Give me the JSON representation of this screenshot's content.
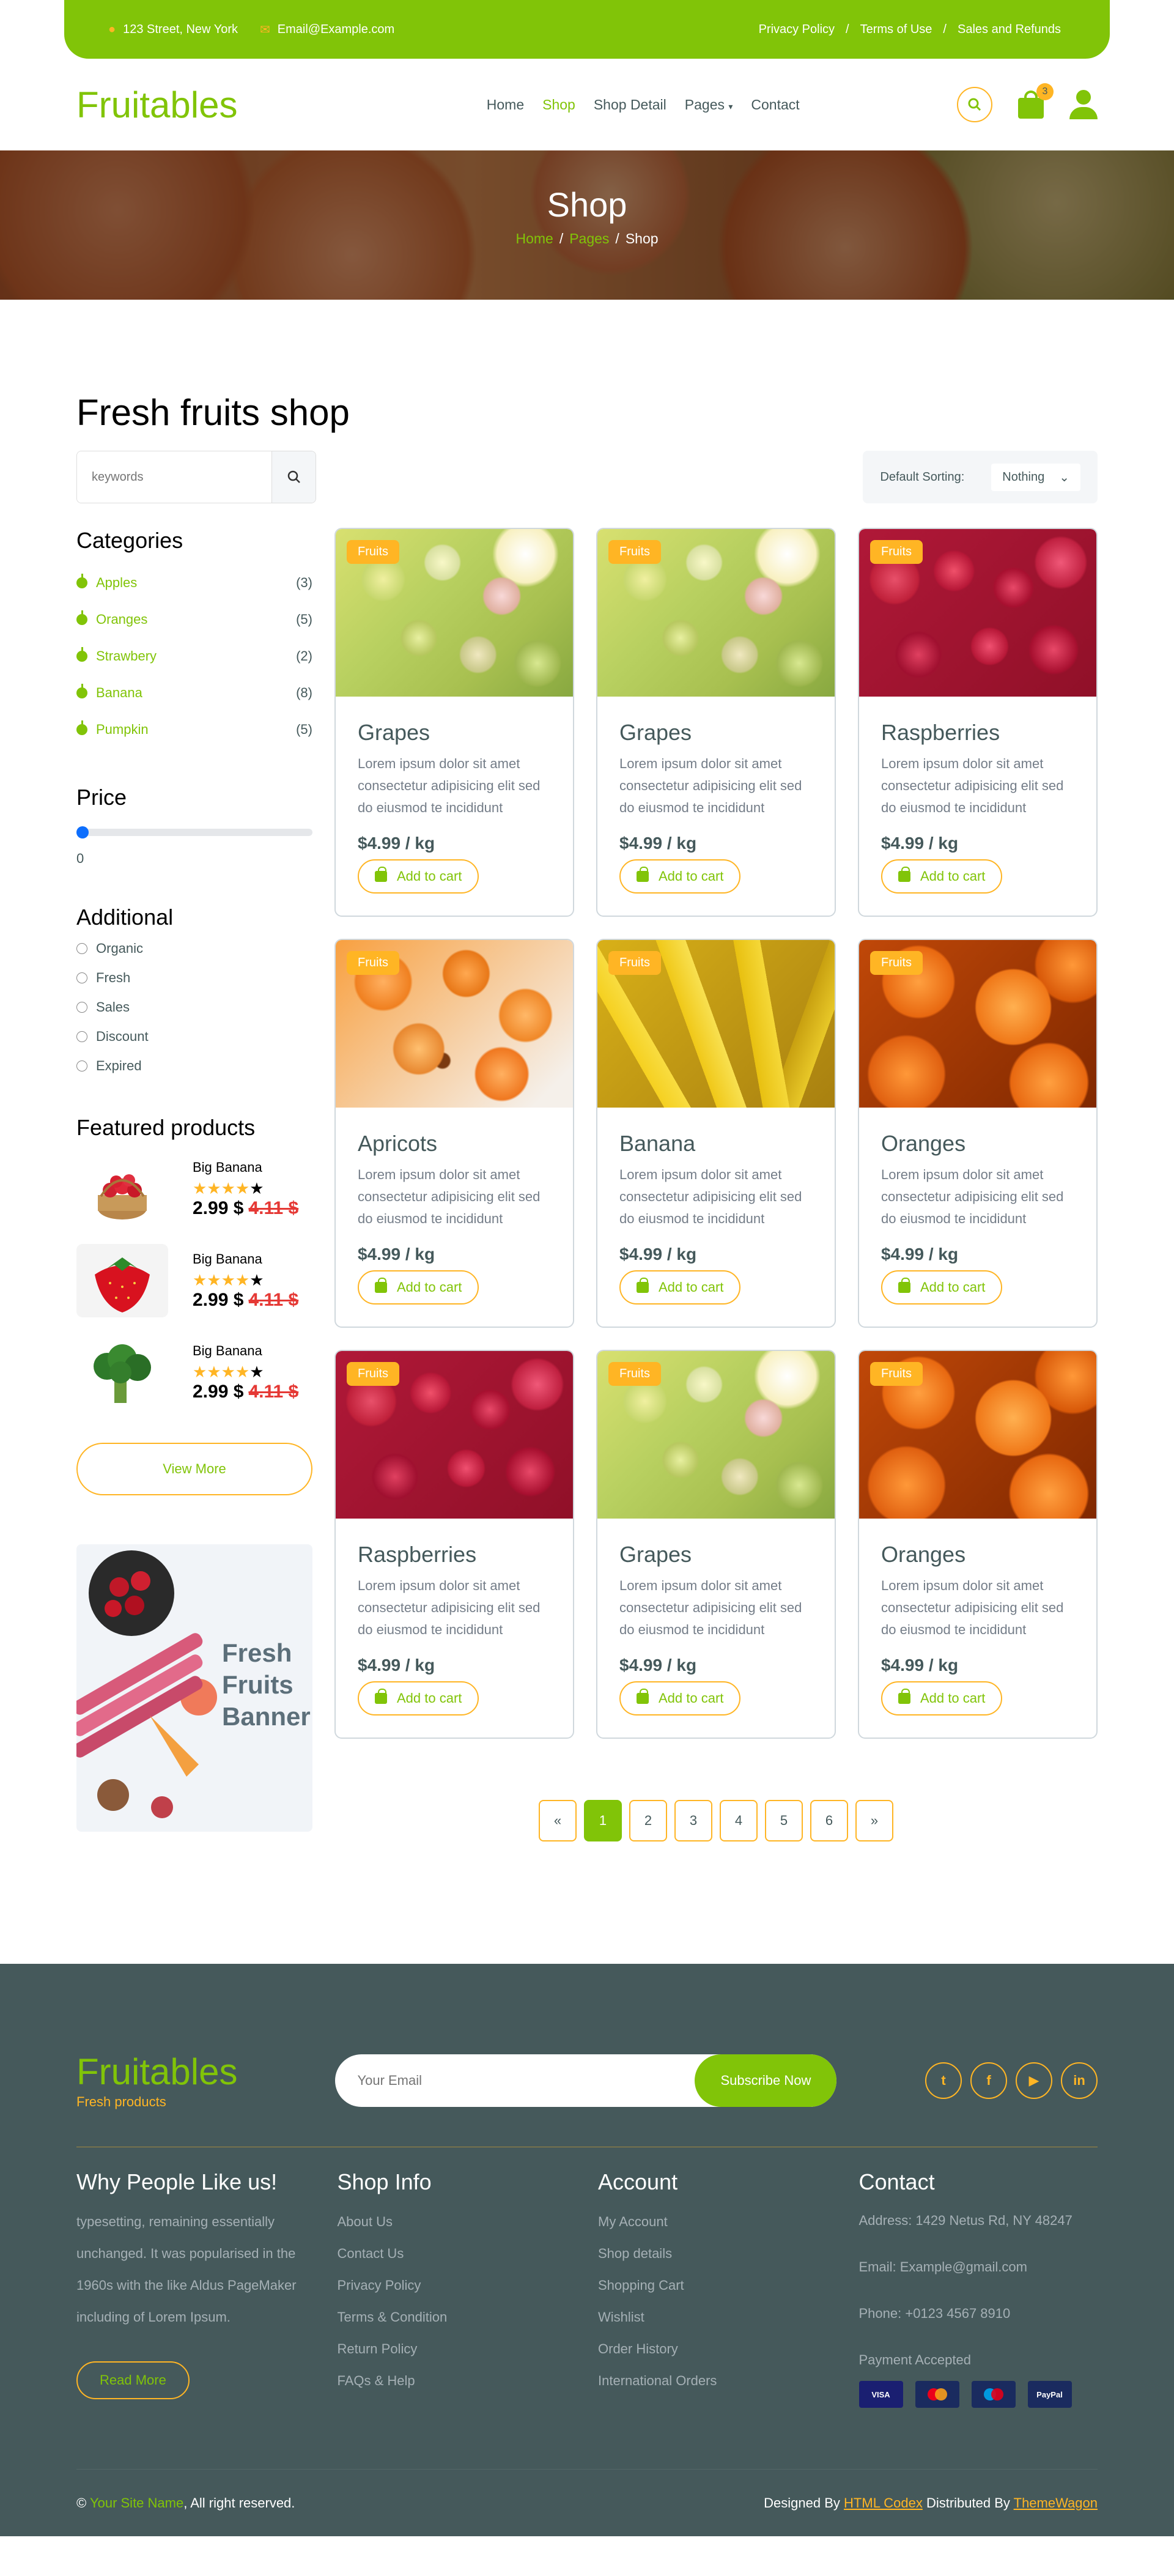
{
  "topbar": {
    "address": "123 Street, New York",
    "email": "Email@Example.com",
    "links": [
      "Privacy Policy",
      "Terms of Use",
      "Sales and Refunds"
    ],
    "separator": "/"
  },
  "nav": {
    "logo": "Fruitables",
    "items": [
      {
        "label": "Home"
      },
      {
        "label": "Shop"
      },
      {
        "label": "Shop Detail"
      },
      {
        "label": "Pages"
      },
      {
        "label": "Contact"
      }
    ],
    "cart_count": "3"
  },
  "hero": {
    "title": "Shop",
    "crumbs": [
      "Home",
      "Pages",
      "Shop"
    ],
    "separator": "/"
  },
  "shop": {
    "title": "Fresh fruits shop",
    "search_placeholder": "keywords",
    "sorting_label": "Default Sorting:",
    "sorting_value": "Nothing",
    "categories_title": "Categories",
    "categories": [
      {
        "label": "Apples",
        "count": "(3)"
      },
      {
        "label": "Oranges",
        "count": "(5)"
      },
      {
        "label": "Strawbery",
        "count": "(2)"
      },
      {
        "label": "Banana",
        "count": "(8)"
      },
      {
        "label": "Pumpkin",
        "count": "(5)"
      }
    ],
    "price_title": "Price",
    "price_value": "0",
    "price_fraction": 0,
    "additional_title": "Additional",
    "additional": [
      "Organic",
      "Fresh",
      "Sales",
      "Discount",
      "Expired"
    ],
    "featured_title": "Featured products",
    "featured": [
      {
        "name": "Big Banana",
        "stars": "★★★★",
        "star_off": "★",
        "price": "2.99 $",
        "old": "4.11 $",
        "image": "basket-strawberries"
      },
      {
        "name": "Big Banana",
        "stars": "★★★★",
        "star_off": "★",
        "price": "2.99 $",
        "old": "4.11 $",
        "image": "strawberry"
      },
      {
        "name": "Big Banana",
        "stars": "★★★★",
        "star_off": "★",
        "price": "2.99 $",
        "old": "4.11 $",
        "image": "broccoli"
      }
    ],
    "view_more": "View More",
    "banner_text": "Fresh Fruits Banner",
    "products": [
      {
        "tag": "Fruits",
        "name": "Grapes",
        "desc": "Lorem ipsum dolor sit amet consectetur adipisicing elit sed do eiusmod te incididunt",
        "price": "$4.99 / kg",
        "btn": "Add to cart",
        "image": "grapes"
      },
      {
        "tag": "Fruits",
        "name": "Grapes",
        "desc": "Lorem ipsum dolor sit amet consectetur adipisicing elit sed do eiusmod te incididunt",
        "price": "$4.99 / kg",
        "btn": "Add to cart",
        "image": "grapes"
      },
      {
        "tag": "Fruits",
        "name": "Raspberries",
        "desc": "Lorem ipsum dolor sit amet consectetur adipisicing elit sed do eiusmod te incididunt",
        "price": "$4.99 / kg",
        "btn": "Add to cart",
        "image": "rasp"
      },
      {
        "tag": "Fruits",
        "name": "Apricots",
        "desc": "Lorem ipsum dolor sit amet consectetur adipisicing elit sed do eiusmod te incididunt",
        "price": "$4.99 / kg",
        "btn": "Add to cart",
        "image": "apric"
      },
      {
        "tag": "Fruits",
        "name": "Banana",
        "desc": "Lorem ipsum dolor sit amet consectetur adipisicing elit sed do eiusmod te incididunt",
        "price": "$4.99 / kg",
        "btn": "Add to cart",
        "image": "banana"
      },
      {
        "tag": "Fruits",
        "name": "Oranges",
        "desc": "Lorem ipsum dolor sit amet consectetur adipisicing elit sed do eiusmod te incididunt",
        "price": "$4.99 / kg",
        "btn": "Add to cart",
        "image": "orange"
      },
      {
        "tag": "Fruits",
        "name": "Raspberries",
        "desc": "Lorem ipsum dolor sit amet consectetur adipisicing elit sed do eiusmod te incididunt",
        "price": "$4.99 / kg",
        "btn": "Add to cart",
        "image": "rasp"
      },
      {
        "tag": "Fruits",
        "name": "Grapes",
        "desc": "Lorem ipsum dolor sit amet consectetur adipisicing elit sed do eiusmod te incididunt",
        "price": "$4.99 / kg",
        "btn": "Add to cart",
        "image": "grapes"
      },
      {
        "tag": "Fruits",
        "name": "Oranges",
        "desc": "Lorem ipsum dolor sit amet consectetur adipisicing elit sed do eiusmod te incididunt",
        "price": "$4.99 / kg",
        "btn": "Add to cart",
        "image": "orange"
      }
    ],
    "pagination": [
      "«",
      "1",
      "2",
      "3",
      "4",
      "5",
      "6",
      "»"
    ],
    "active_page": "1"
  },
  "footer": {
    "logo": "Fruitables",
    "tagline": "Fresh products",
    "email_placeholder": "Your Email",
    "subscribe": "Subscribe Now",
    "socials": [
      {
        "icon": "twitter-icon",
        "glyph": "t"
      },
      {
        "icon": "facebook-icon",
        "glyph": "f"
      },
      {
        "icon": "youtube-icon",
        "glyph": "▶"
      },
      {
        "icon": "linkedin-icon",
        "glyph": "in"
      }
    ],
    "why_title": "Why People Like us!",
    "why_text": "typesetting, remaining essentially unchanged. It was popularised in the 1960s with the like Aldus PageMaker including of Lorem Ipsum.",
    "read_more": "Read More",
    "shop_info_title": "Shop Info",
    "shop_info": [
      "About Us",
      "Contact Us",
      "Privacy Policy",
      "Terms & Condition",
      "Return Policy",
      "FAQs & Help"
    ],
    "account_title": "Account",
    "account": [
      "My Account",
      "Shop details",
      "Shopping Cart",
      "Wishlist",
      "Order History",
      "International Orders"
    ],
    "contact_title": "Contact",
    "address": "Address: 1429 Netus Rd, NY 48247",
    "email": "Email: Example@gmail.com",
    "phone": "Phone: +0123 4567 8910",
    "payment": "Payment Accepted",
    "cards": [
      "VISA",
      "",
      "",
      "PayPal"
    ]
  },
  "copyright": {
    "site": "Your Site Name",
    "rights": ", All right reserved.",
    "designed": "Designed By",
    "designer": "HTML Codex",
    "distributed": "Distributed By",
    "distributor": "ThemeWagon"
  },
  "colors": {
    "primary": "#81c408",
    "secondary": "#ffb524",
    "dark": "#45595b"
  }
}
